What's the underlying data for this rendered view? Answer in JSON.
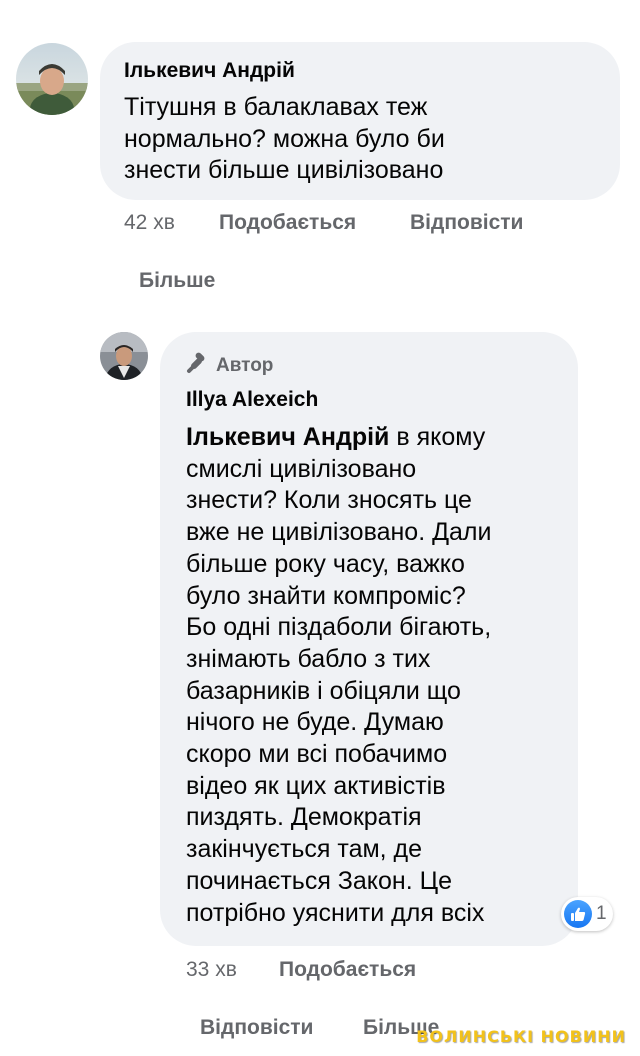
{
  "comment1": {
    "author": "Ількевич Андрій",
    "text_lines": [
      "Тітушня в балаклавах теж",
      "нормально? можна було би",
      "знести більше цивілізовано"
    ],
    "time": "42 хв",
    "like_label": "Подобається",
    "reply_label": "Відповісти",
    "more_label": "Більше"
  },
  "comment2": {
    "badge": "Автор",
    "author": "Illya Alexeich",
    "mention": "Ількевич Андрій",
    "text_first_rest": " в якому",
    "text_lines": [
      "смислі цивілізовано",
      "знести? Коли зносять це",
      "вже не цивілізовано. Дали",
      "більше року часу, важко",
      "було знайти компроміс?",
      "Бо одні піздаболи бігають,",
      "знімають бабло з тих",
      "базарників і обіцяли що",
      "нічого не буде. Думаю",
      "скоро ми всі побачимо",
      "відео як цих активістів",
      "пиздять. Демократія",
      "закінчується там, де",
      "починається Закон. Це",
      "потрібно уяснити для всіх"
    ],
    "reaction_count": "1",
    "time": "33 хв",
    "like_label": "Подобається",
    "reply_label": "Відповісти",
    "more_label": "Більше"
  },
  "watermark": "ВОЛИНСЬКІ НОВИНИ",
  "icons": {
    "badge_icon": "microphone-icon",
    "reaction_icon": "like-thumb-icon"
  },
  "colors": {
    "bubble": "#f0f2f5",
    "meta_text": "#65676b",
    "like_blue": "#1877f2",
    "watermark": "#f2c21b"
  }
}
